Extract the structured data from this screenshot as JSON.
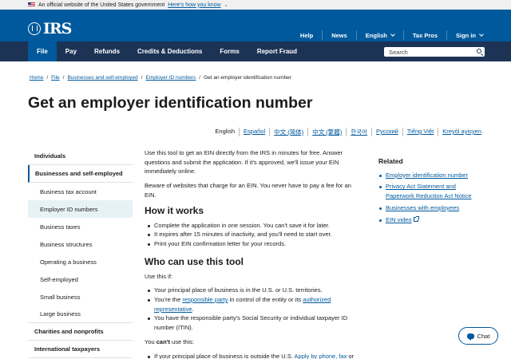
{
  "gov_banner": {
    "text": "An official website of the United States government",
    "link": "Here's how you know"
  },
  "header": {
    "logo": "IRS",
    "util_links": [
      "Help",
      "News",
      "English",
      "Tax Pros",
      "Sign in"
    ]
  },
  "main_nav": {
    "items": [
      "File",
      "Pay",
      "Refunds",
      "Credits & Deductions",
      "Forms",
      "Report Fraud"
    ],
    "active": "File",
    "search_placeholder": "Search"
  },
  "breadcrumb": [
    "Home",
    "File",
    "Businesses and self-employed",
    "Employer ID numbers",
    "Get an employer identification number"
  ],
  "page_title": "Get an employer identification number",
  "languages": [
    "English",
    "Español",
    "中文 (简体)",
    "中文 (繁體)",
    "한국어",
    "Русский",
    "Tiếng Việt",
    "Kreyòl ayisyen"
  ],
  "sidebar": {
    "items": [
      "Individuals",
      "Businesses and self-employed",
      "Business tax account",
      "Employer ID numbers",
      "Business taxes",
      "Business structures",
      "Operating a business",
      "Self-employed",
      "Small business",
      "Large business",
      "Charities and nonprofits",
      "International taxpayers"
    ]
  },
  "content": {
    "intro": "Use this tool to get an EIN directly from the IRS in minutes for free. Answer questions and submit the application. If it's approved, we'll issue your EIN immediately online.",
    "beware": "Beware of websites that charge for an EIN. You never have to pay a fee for an EIN.",
    "how_heading": "How it works",
    "how_items": [
      "Complete the application in one session. You can't save it for later.",
      "It expires after 15 minutes of inactivity, and you'll need to start over.",
      "Print your EIN confirmation letter for your records."
    ],
    "who_heading": "Who can use this tool",
    "use_if": "Use this if:",
    "who_item1": "Your principal place of business is in the U.S. or U.S. territories.",
    "who_item2_pre": "You're the ",
    "who_item2_link1": "responsible party",
    "who_item2_mid": " in control of the entity or its ",
    "who_item2_link2": "authorized representative",
    "who_item2_post": ".",
    "who_item3": "You have the responsible party's Social Security or individual taxpayer ID number (ITIN).",
    "cant_pre": "You ",
    "cant_bold": "can't",
    "cant_post": " use this:",
    "cant_item_pre": "If your principal place of business is outside the U.S. ",
    "cant_item_link": "Apply by phone, fax",
    "cant_item_post": " or mail."
  },
  "related": {
    "heading": "Related",
    "links": [
      "Employer identification number",
      "Privacy Act Statement and Paperwork Reduction Act Notice",
      "Businesses with employees",
      "EIN video"
    ]
  },
  "chat": {
    "label": "Chat"
  },
  "colors": {
    "header_blue": "#00599c",
    "nav_navy": "#1c3356",
    "link_blue": "#00599c"
  }
}
